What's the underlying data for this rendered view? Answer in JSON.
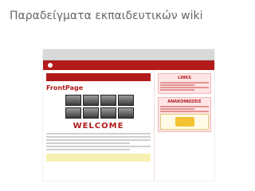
{
  "slide": {
    "title": "Παραδείγματα εκπαιδευτικών wiki"
  },
  "screenshot": {
    "frontpage_heading": "FrontPage",
    "welcome_text": "WELCOME",
    "side": {
      "links_title": "LINKS",
      "announcements_title": "ΑΝΑΚΟΙΝΩΣΕΙΣ"
    }
  },
  "colors": {
    "accent": "#b31b1b",
    "title_text": "#666666"
  }
}
